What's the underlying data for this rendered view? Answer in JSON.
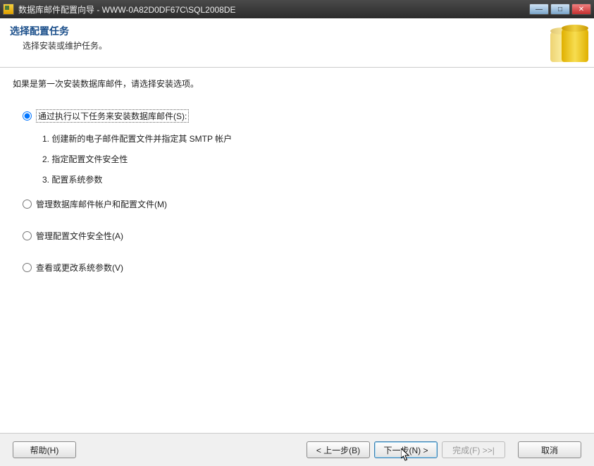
{
  "window": {
    "title": "数据库邮件配置向导 - WWW-0A82D0DF67C\\SQL2008DE"
  },
  "header": {
    "title": "选择配置任务",
    "subtitle": "选择安装或维护任务。"
  },
  "intro": "如果是第一次安装数据库邮件，请选择安装选项。",
  "options": [
    {
      "id": "opt_install",
      "label": "通过执行以下任务来安装数据库邮件(S):",
      "selected": true,
      "sub": [
        "1.  创建新的电子邮件配置文件并指定其 SMTP 帐户",
        "2.  指定配置文件安全性",
        "3.  配置系统参数"
      ]
    },
    {
      "id": "opt_manage_accounts",
      "label": "管理数据库邮件帐户和配置文件(M)",
      "selected": false
    },
    {
      "id": "opt_manage_security",
      "label": "管理配置文件安全性(A)",
      "selected": false
    },
    {
      "id": "opt_view_params",
      "label": "查看或更改系统参数(V)",
      "selected": false
    }
  ],
  "buttons": {
    "help": "帮助(H)",
    "back": "< 上一步(B)",
    "next": "下一步(N) >",
    "finish": "完成(F) >>|",
    "cancel": "取消"
  }
}
